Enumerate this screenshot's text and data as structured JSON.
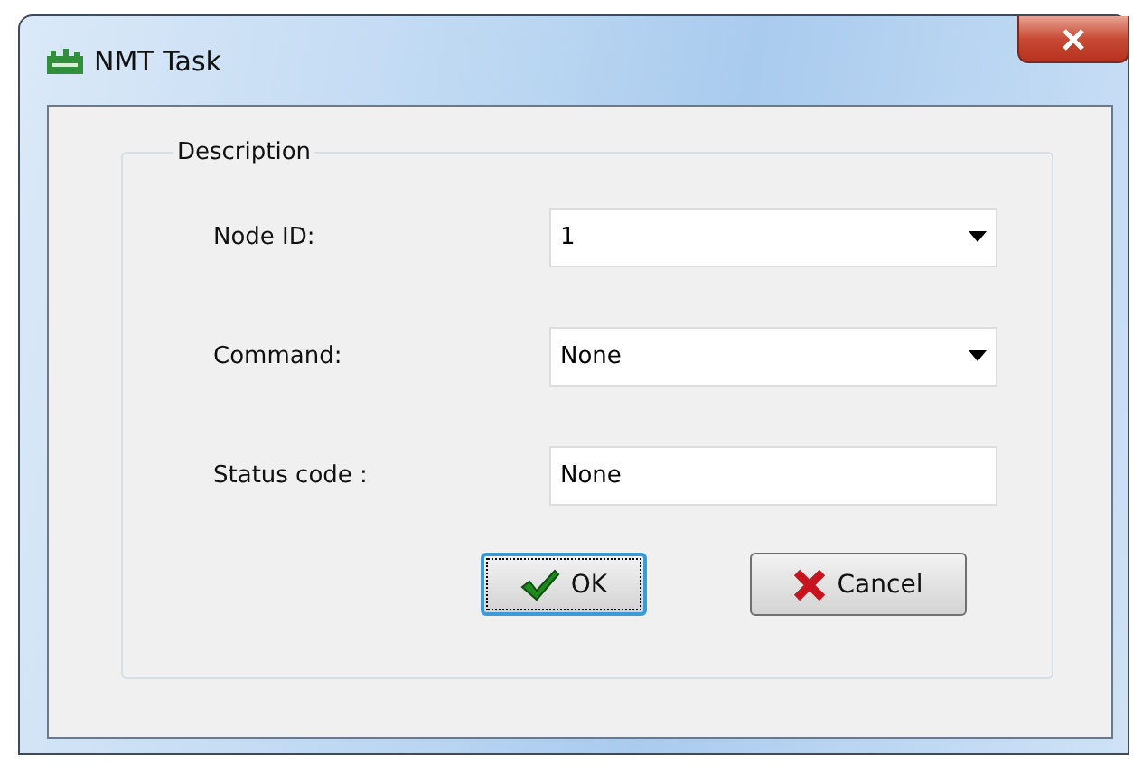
{
  "window": {
    "title": "NMT Task"
  },
  "group": {
    "title": "Description",
    "fields": [
      {
        "label": "Node ID:",
        "kind": "dropdown",
        "value": "1"
      },
      {
        "label": "Command:",
        "kind": "dropdown",
        "value": "None"
      },
      {
        "label": "Status code :",
        "kind": "text",
        "value": "None"
      }
    ]
  },
  "buttons": [
    {
      "label": "OK",
      "kind": "ok",
      "focused": true
    },
    {
      "label": "Cancel",
      "kind": "cancel",
      "focused": false
    }
  ]
}
